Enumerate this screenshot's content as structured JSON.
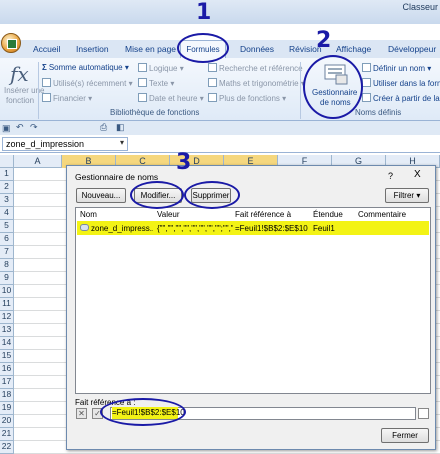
{
  "window": {
    "title": "Classeur"
  },
  "tabs": [
    "Accueil",
    "Insertion",
    "Mise en page",
    "Formules",
    "Données",
    "Révision",
    "Affichage",
    "Développeur"
  ],
  "ribbon": {
    "insert_function_line1": "Insérer une",
    "insert_function_line2": "fonction",
    "autosum": "Somme automatique",
    "recent": "Utilisé(s) récemment",
    "financial": "Financier",
    "logical": "Logique",
    "text": "Texte",
    "datetime": "Date et heure",
    "lookup": "Recherche et référence",
    "math": "Maths et trigonométrie",
    "more": "Plus de fonctions",
    "library_label": "Bibliothèque de fonctions",
    "name_manager_line1": "Gestionnaire",
    "name_manager_line2": "de noms",
    "define_name": "Définir un nom",
    "use_in_formula": "Utiliser dans la formule",
    "create_from_selection": "Créer à partir de la sélection",
    "names_label": "Noms définis"
  },
  "namebox": {
    "value": "zone_d_impression"
  },
  "columns": [
    "A",
    "B",
    "C",
    "D",
    "E",
    "F",
    "G",
    "H"
  ],
  "rows": [
    "1",
    "2",
    "3",
    "4",
    "5",
    "6",
    "7",
    "8",
    "9",
    "10",
    "11",
    "12",
    "13",
    "14",
    "15",
    "16",
    "17",
    "18",
    "19",
    "20",
    "21",
    "22"
  ],
  "dialog": {
    "title": "Gestionnaire de noms",
    "help": "?",
    "close": "X",
    "new_button": "Nouveau...",
    "edit_button": "Modifier...",
    "delete_button": "Supprimer",
    "filter_button": "Filtrer",
    "headers": [
      "Nom",
      "Valeur",
      "Fait référence à",
      "Étendue",
      "Commentaire"
    ],
    "row": {
      "name": "zone_d_impress...",
      "value": "{\"\",\"\",\"\",\"\",\"\",\"\",\"\",\"\";\"\",\"\"...",
      "refers_to": "=Feuil1!$B$2:$E$10",
      "scope": "Feuil1",
      "comment": ""
    },
    "refers_to_label": "Fait référence à :",
    "refers_to_value": "=Feuil1!$B$2:$E$10",
    "close_button": "Fermer"
  },
  "annotations": {
    "one": "1",
    "two": "2",
    "three": "3"
  },
  "colors": {
    "highlight": "#f3f315",
    "annotation": "#1a1aa6"
  }
}
